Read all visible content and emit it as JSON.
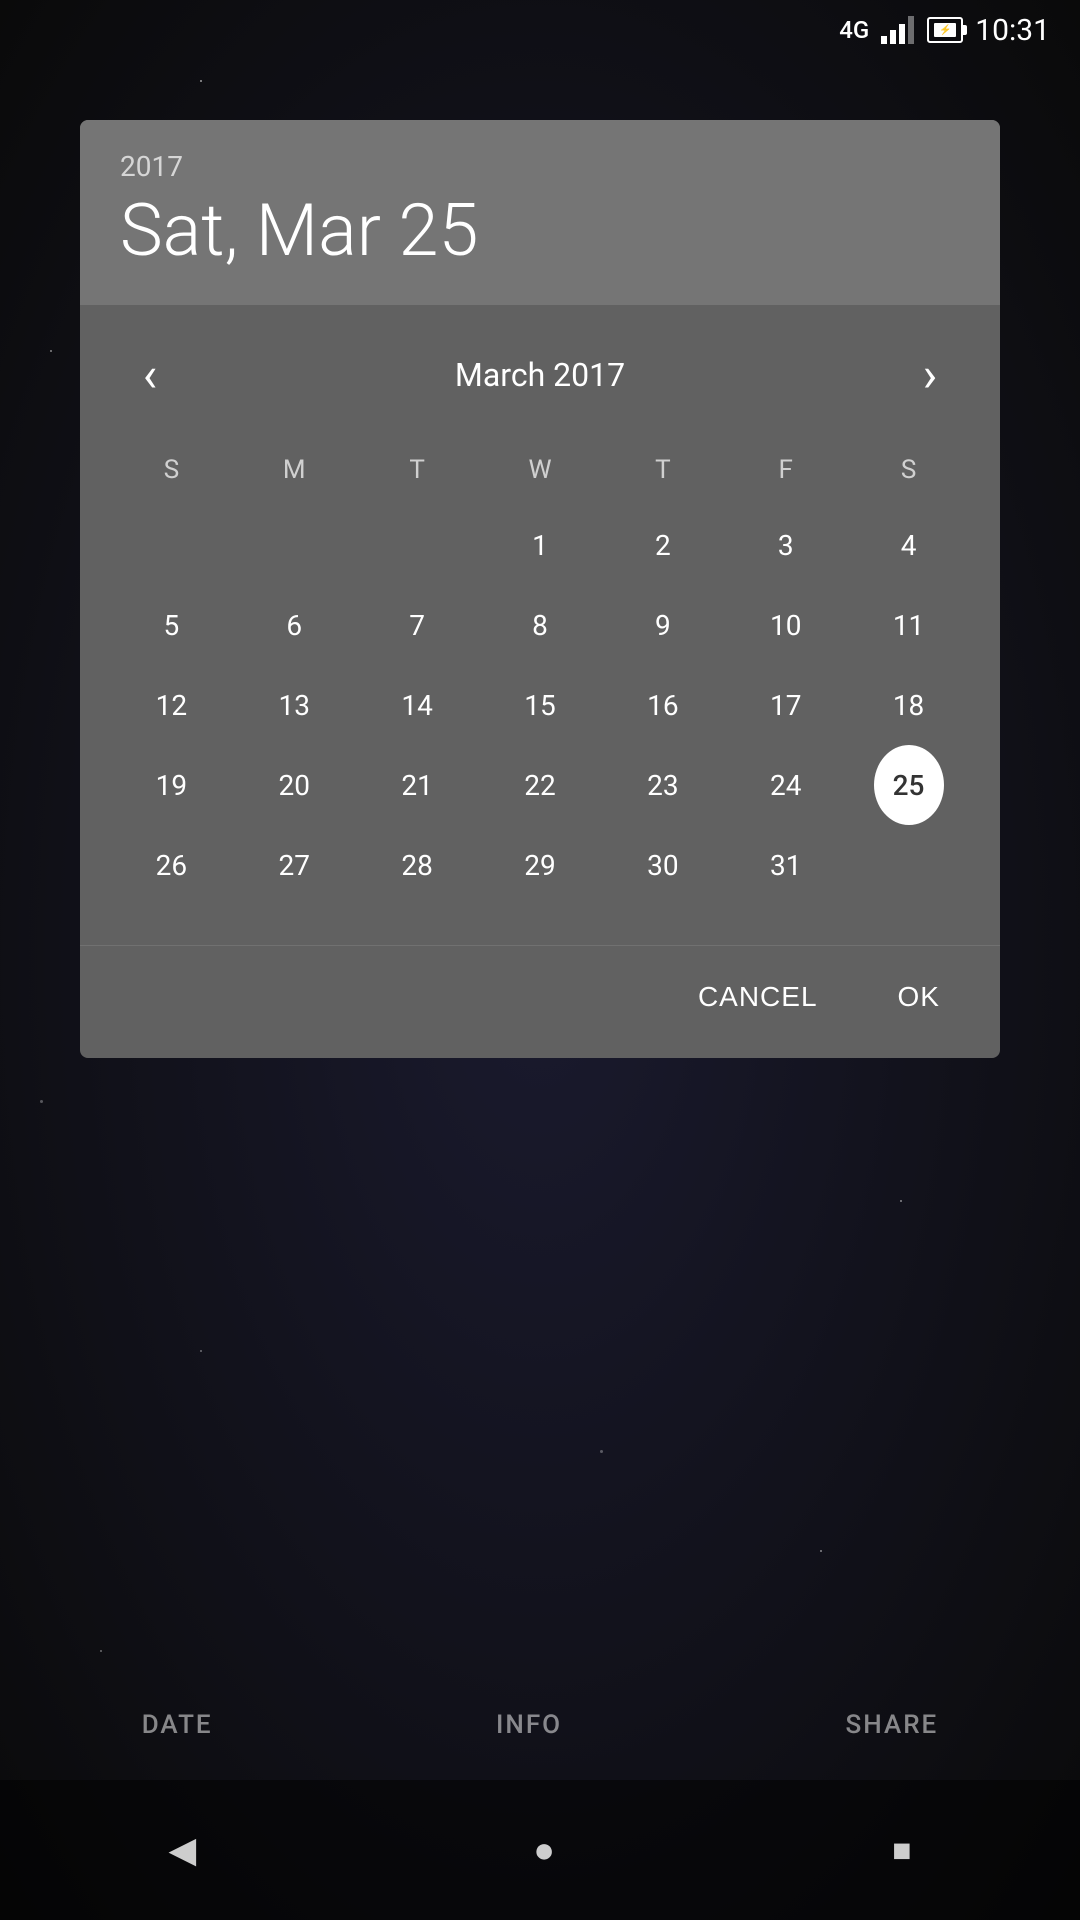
{
  "status_bar": {
    "signal": "4G",
    "time": "10:31"
  },
  "dialog": {
    "year": "2017",
    "selected_date_label": "Sat, Mar 25",
    "month_title": "March 2017",
    "selected_day": 25,
    "day_headers": [
      "S",
      "M",
      "T",
      "W",
      "T",
      "F",
      "S"
    ],
    "weeks": [
      [
        "",
        "",
        "",
        "1",
        "2",
        "3",
        "4"
      ],
      [
        "5",
        "6",
        "7",
        "8",
        "9",
        "10",
        "11"
      ],
      [
        "12",
        "13",
        "14",
        "15",
        "16",
        "17",
        "18"
      ],
      [
        "19",
        "20",
        "21",
        "22",
        "23",
        "24",
        "25"
      ],
      [
        "26",
        "27",
        "28",
        "29",
        "30",
        "31",
        ""
      ]
    ],
    "cancel_label": "CANCEL",
    "ok_label": "OK"
  },
  "bottom_nav": {
    "date_label": "DATE",
    "info_label": "INFO",
    "share_label": "SHARE"
  },
  "icons": {
    "back": "◀",
    "home": "●",
    "recents": "■",
    "chevron_left": "‹",
    "chevron_right": "›"
  }
}
